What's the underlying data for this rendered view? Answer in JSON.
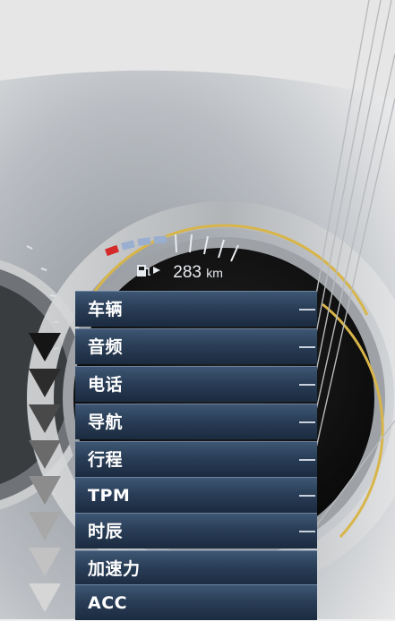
{
  "cluster": {
    "range_value": "283",
    "range_unit": "km",
    "fuel_icon": "fuel-pump-icon"
  },
  "menu": {
    "items": [
      {
        "label": "车辆"
      },
      {
        "label": "音频"
      },
      {
        "label": "电话"
      },
      {
        "label": "导航"
      },
      {
        "label": "行程"
      },
      {
        "label": "TPM"
      },
      {
        "label": "时辰"
      },
      {
        "label": "加速力"
      },
      {
        "label": "ACC"
      }
    ]
  },
  "colors": {
    "menu_top": "#3e5774",
    "menu_bottom": "#1b2b40",
    "ring": "#d8b54a",
    "gauge_red": "#d42a2a",
    "gauge_blue": "#9aaed0"
  }
}
